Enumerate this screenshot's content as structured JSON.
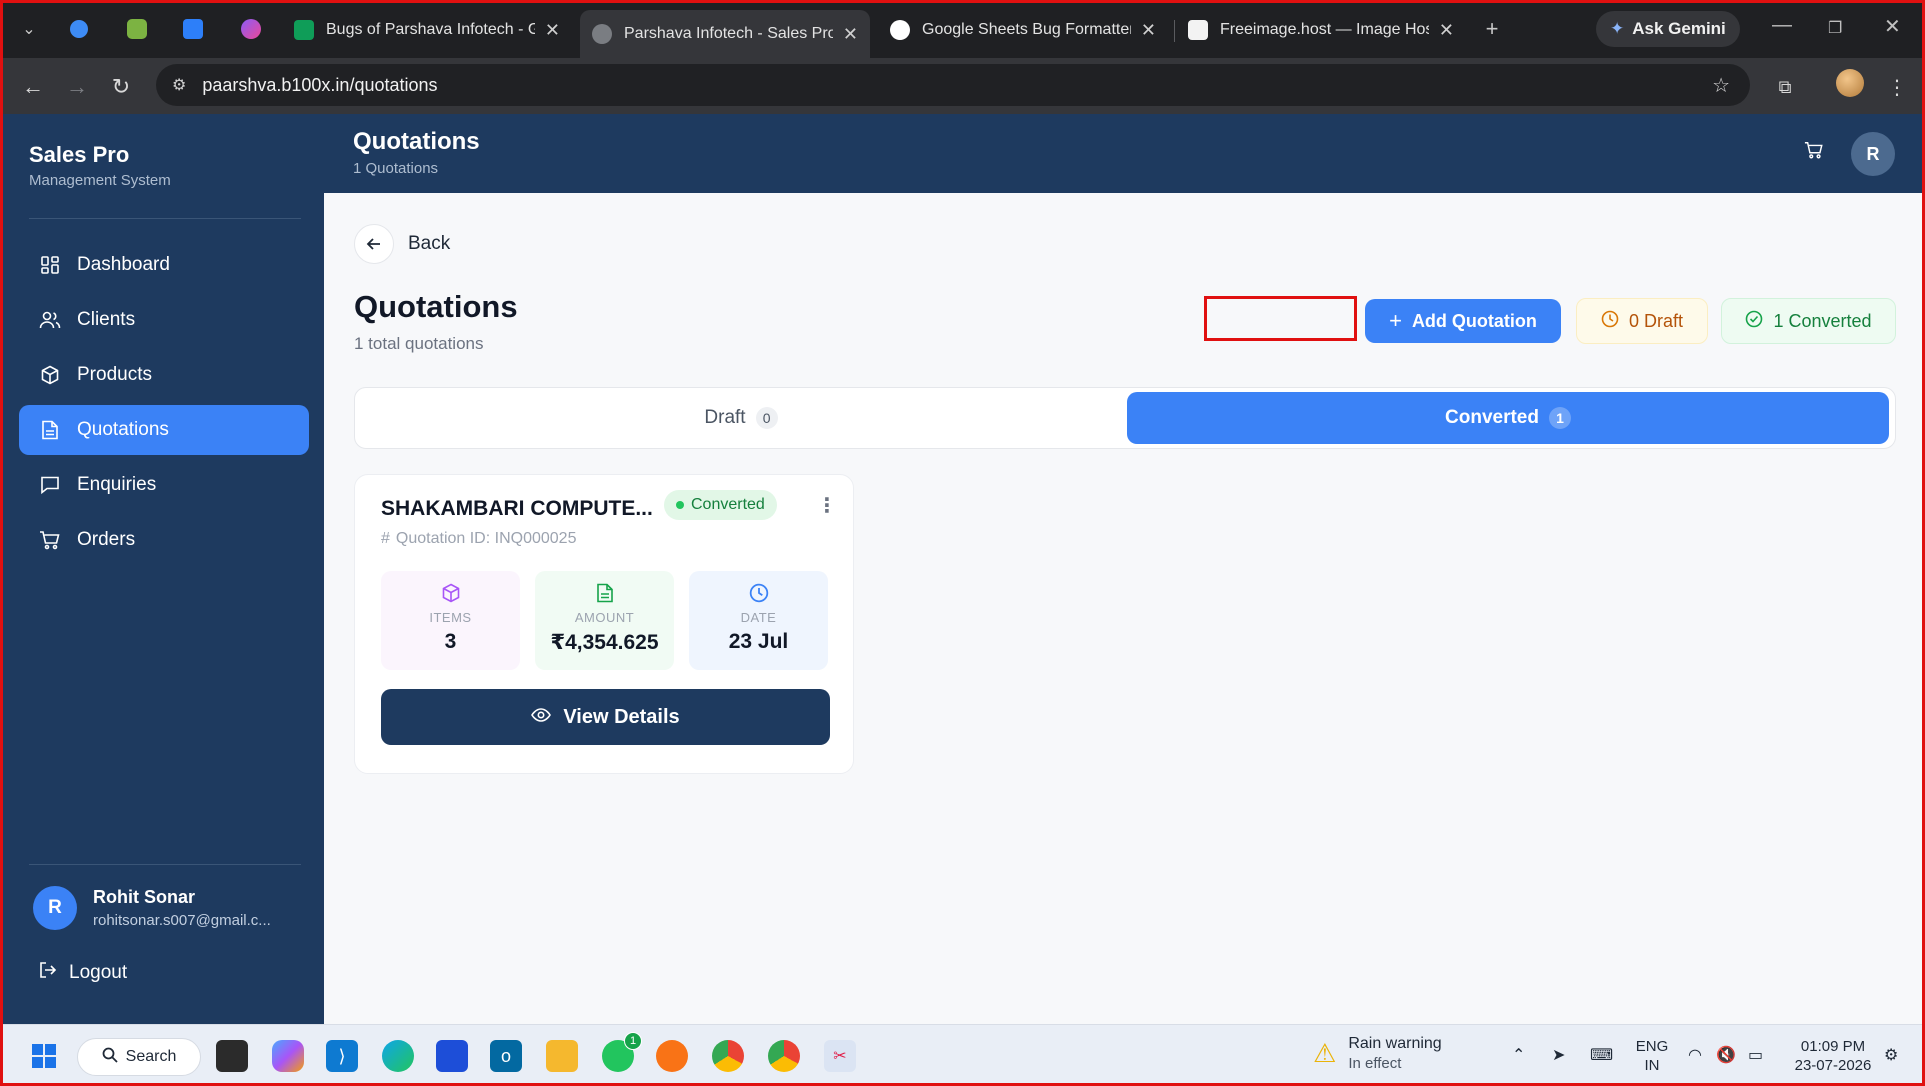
{
  "browser": {
    "tabs": [
      {
        "title": "Bugs of Parshava Infotech - Goo",
        "favicon_color": "#0f9d58"
      },
      {
        "title": "Parshava Infotech - Sales Pro | S",
        "favicon_color": "#7a7d82",
        "active": true
      },
      {
        "title": "Google Sheets Bug Formatter",
        "favicon_color": "#ffffff"
      },
      {
        "title": "Freeimage.host — Image Hostin",
        "favicon_color": "#f3f3f3"
      }
    ],
    "ask_gemini": "Ask Gemini",
    "url": "paarshva.b100x.in/quotations"
  },
  "sidebar": {
    "brand": "Sales Pro",
    "brand_sub": "Management System",
    "items": [
      {
        "label": "Dashboard",
        "icon": "grid-icon"
      },
      {
        "label": "Clients",
        "icon": "users-icon"
      },
      {
        "label": "Products",
        "icon": "box-icon"
      },
      {
        "label": "Quotations",
        "icon": "document-icon",
        "active": true
      },
      {
        "label": "Enquiries",
        "icon": "message-icon"
      },
      {
        "label": "Orders",
        "icon": "cart-icon"
      }
    ],
    "user": {
      "initial": "R",
      "name": "Rohit Sonar",
      "email": "rohitsonar.s007@gmail.c..."
    },
    "logout": "Logout"
  },
  "topbar": {
    "title": "Quotations",
    "subtitle": "1 Quotations",
    "avatar": "R"
  },
  "main": {
    "back": "Back",
    "title": "Quotations",
    "subtitle": "1 total quotations",
    "add_button": "Add Quotation",
    "draft_pill": "0 Draft",
    "converted_pill": "1 Converted",
    "tabs": [
      {
        "label": "Draft",
        "count": "0"
      },
      {
        "label": "Converted",
        "count": "1",
        "active": true
      }
    ]
  },
  "card": {
    "client": "SHAKAMBARI COMPUTE...",
    "status": "Converted",
    "quotation_id": "Quotation ID: INQ000025",
    "stats": {
      "items": {
        "label": "ITEMS",
        "value": "3"
      },
      "amount": {
        "label": "AMOUNT",
        "value": "₹4,354.625"
      },
      "date": {
        "label": "DATE",
        "value": "23 Jul"
      }
    },
    "view_button": "View Details"
  },
  "taskbar": {
    "search": "Search",
    "weather_title": "Rain warning",
    "weather_sub": "In effect",
    "lang_top": "ENG",
    "lang_bottom": "IN",
    "time": "01:09 PM",
    "date": "23-07-2026",
    "whatsapp_badge": "1"
  },
  "colors": {
    "sidebar": "#1e3a5f",
    "accent": "#3b82f6",
    "success": "#15803d",
    "warning": "#b45309"
  }
}
